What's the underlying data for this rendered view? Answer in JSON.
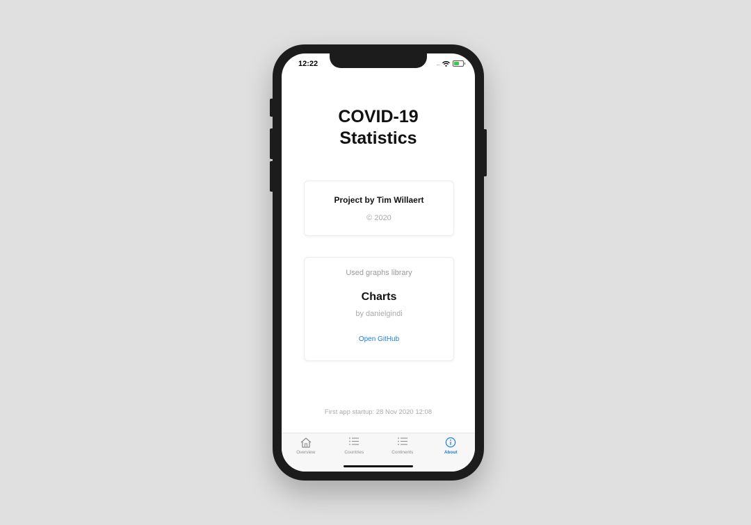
{
  "status_bar": {
    "time": "12:22",
    "signal": "....",
    "battery_level": 0.6
  },
  "title": {
    "line1": "COVID-19",
    "line2": "Statistics"
  },
  "project_card": {
    "author": "Project by Tim Willaert",
    "copyright": "© 2020"
  },
  "library_card": {
    "caption": "Used graphs library",
    "name": "Charts",
    "author": "by danielgindi",
    "link_label": "Open GitHub"
  },
  "footer": {
    "startup": "First app startup: 28 Nov 2020 12:08"
  },
  "tabs": [
    {
      "label": "Overview",
      "icon": "house-icon",
      "active": false
    },
    {
      "label": "Countries",
      "icon": "list-icon",
      "active": false
    },
    {
      "label": "Continents",
      "icon": "list-icon",
      "active": false
    },
    {
      "label": "About",
      "icon": "info-icon",
      "active": true
    }
  ],
  "colors": {
    "accent": "#1a7ee0",
    "background": "#e0e0e0",
    "phone_frame": "#1c1c1c"
  }
}
